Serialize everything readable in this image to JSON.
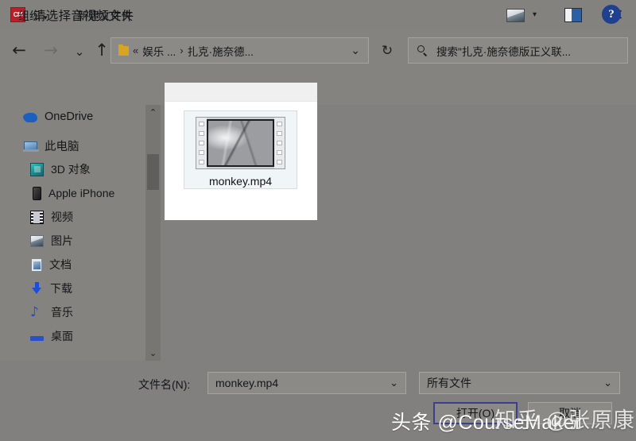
{
  "window": {
    "title": "请选择音视频文件",
    "app_icon": "CM",
    "close_label": "✕"
  },
  "nav": {
    "back_icon": "←",
    "forward_icon": "→",
    "recent_icon": "⌄",
    "up_icon": "↑",
    "refresh_icon": "↻"
  },
  "address": {
    "prefix": "«",
    "crumb1": "娱乐 ...",
    "separator": "›",
    "crumb2": "扎克·施奈德...",
    "chevron": "⌄"
  },
  "search": {
    "text": "搜索\"扎克·施奈德版正义联..."
  },
  "toolbar": {
    "organize": "组织",
    "organize_caret": "▾",
    "new_folder": "新建文件夹",
    "viewmode_caret": "▾",
    "help": "?"
  },
  "sidebar": {
    "items": [
      {
        "label": "OneDrive",
        "icon": "onedrive-icon"
      },
      {
        "label": "此电脑",
        "icon": "this-pc-icon"
      },
      {
        "label": "3D 对象",
        "icon": "3d-objects-icon"
      },
      {
        "label": "Apple iPhone",
        "icon": "apple-iphone-icon"
      },
      {
        "label": "视频",
        "icon": "videos-icon"
      },
      {
        "label": "图片",
        "icon": "pictures-icon"
      },
      {
        "label": "文档",
        "icon": "documents-icon"
      },
      {
        "label": "下载",
        "icon": "downloads-icon"
      },
      {
        "label": "音乐",
        "icon": "music-icon"
      },
      {
        "label": "桌面",
        "icon": "desktop-icon"
      }
    ],
    "scroll_up": "⌃",
    "scroll_down": "⌄"
  },
  "files": {
    "items": [
      {
        "name": "monkey.mp4",
        "type": "video",
        "selected": true
      }
    ]
  },
  "form": {
    "filename_label": "文件名(N):",
    "filename_value": "monkey.mp4",
    "filename_chevron": "⌄",
    "filetype_value": "所有文件",
    "filetype_chevron": "⌄",
    "open_button": "打开(O)",
    "cancel_button": "取消"
  },
  "watermarks": {
    "toutiao": "头条 @CourseMaker",
    "zhihu": "知乎 @张原康"
  },
  "colors": {
    "accent": "#1f3f8f",
    "brand_red": "#b8202a",
    "panel_bg": "#ffffff",
    "dialog_bg": "#81807f",
    "selection": "#f0f5f8"
  }
}
